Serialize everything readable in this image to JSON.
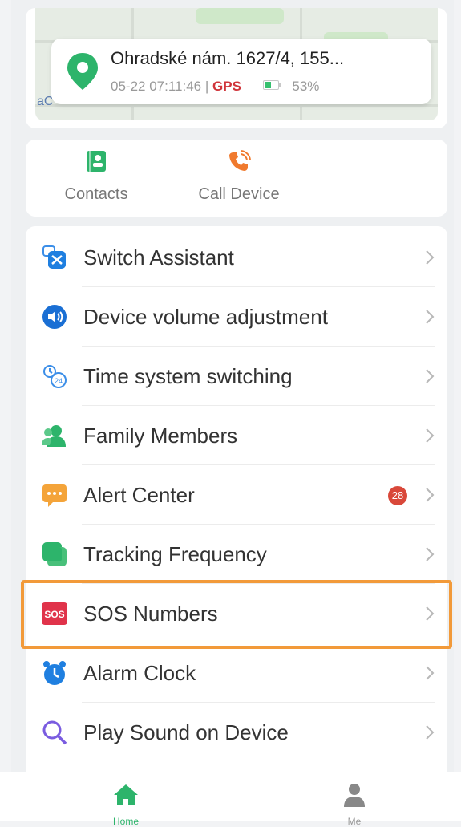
{
  "location": {
    "address": "Ohradské nám. 1627/4, 155...",
    "datetime": "05-22 07:11:46",
    "separator": "|",
    "source": "GPS",
    "battery": "53%",
    "battery_level": 0.53
  },
  "quick_actions": [
    {
      "label": "Contacts",
      "icon": "contacts-icon"
    },
    {
      "label": "Call Device",
      "icon": "phone-call-icon"
    }
  ],
  "menu": [
    {
      "label": "Switch Assistant",
      "icon": "switch-assistant-icon"
    },
    {
      "label": "Device volume adjustment",
      "icon": "volume-icon"
    },
    {
      "label": "Time system switching",
      "icon": "time-system-icon"
    },
    {
      "label": "Family Members",
      "icon": "family-members-icon"
    },
    {
      "label": "Alert Center",
      "icon": "alert-center-icon",
      "badge": "28"
    },
    {
      "label": "Tracking Frequency",
      "icon": "tracking-frequency-icon"
    },
    {
      "label": "SOS Numbers",
      "icon": "sos-icon",
      "highlighted": true
    },
    {
      "label": "Alarm Clock",
      "icon": "alarm-clock-icon"
    },
    {
      "label": "Play Sound on Device",
      "icon": "search-sound-icon"
    }
  ],
  "sos_icon_text": "SOS",
  "bottom_nav": [
    {
      "label": "Home",
      "icon": "home-icon",
      "active": true
    },
    {
      "label": "Me",
      "icon": "person-icon",
      "active": false
    }
  ],
  "colors": {
    "accent_green": "#2db46b",
    "gps_red": "#d0343a",
    "highlight_orange": "#f29a3a",
    "badge_red": "#d9483a"
  }
}
